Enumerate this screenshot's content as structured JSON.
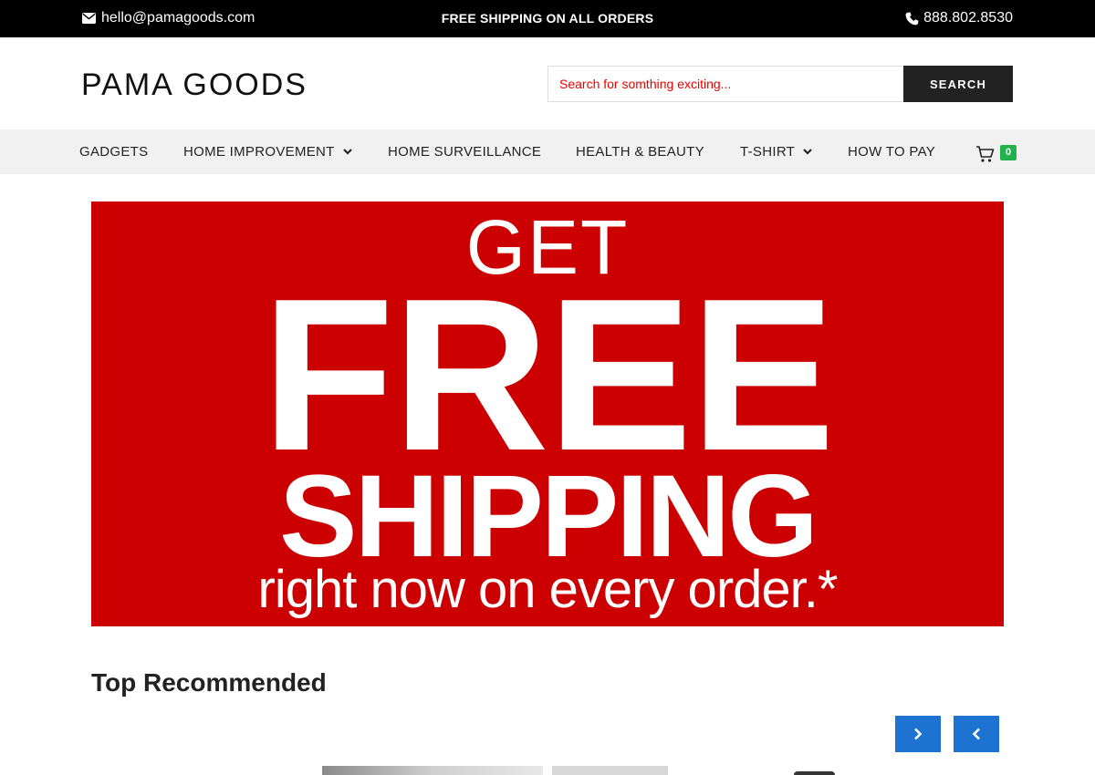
{
  "topbar": {
    "email": "hello@pamagoods.com",
    "promo": "FREE SHIPPING ON ALL ORDERS",
    "phone": "888.802.8530"
  },
  "header": {
    "logo": "PAMA GOODS",
    "search_placeholder": "Search for somthing exciting...",
    "search_button": "SEARCH"
  },
  "nav": {
    "items": [
      {
        "label": "GADGETS",
        "has_dropdown": false
      },
      {
        "label": "HOME IMPROVEMENT",
        "has_dropdown": true
      },
      {
        "label": "HOME SURVEILLANCE",
        "has_dropdown": false
      },
      {
        "label": "HEALTH & BEAUTY",
        "has_dropdown": false
      },
      {
        "label": "T-SHIRT",
        "has_dropdown": true
      },
      {
        "label": "HOW TO PAY",
        "has_dropdown": false
      }
    ],
    "cart_count": "0"
  },
  "banner": {
    "line1": "GET",
    "line2": "FREE",
    "line3": "SHIPPING",
    "line4": "right now on every order.*"
  },
  "section": {
    "title": "Top Recommended"
  },
  "colors": {
    "banner_bg": "#cc0000",
    "accent_blue": "#1e73d2",
    "cart_badge": "#22b14c",
    "topbar_bg": "#000000"
  }
}
